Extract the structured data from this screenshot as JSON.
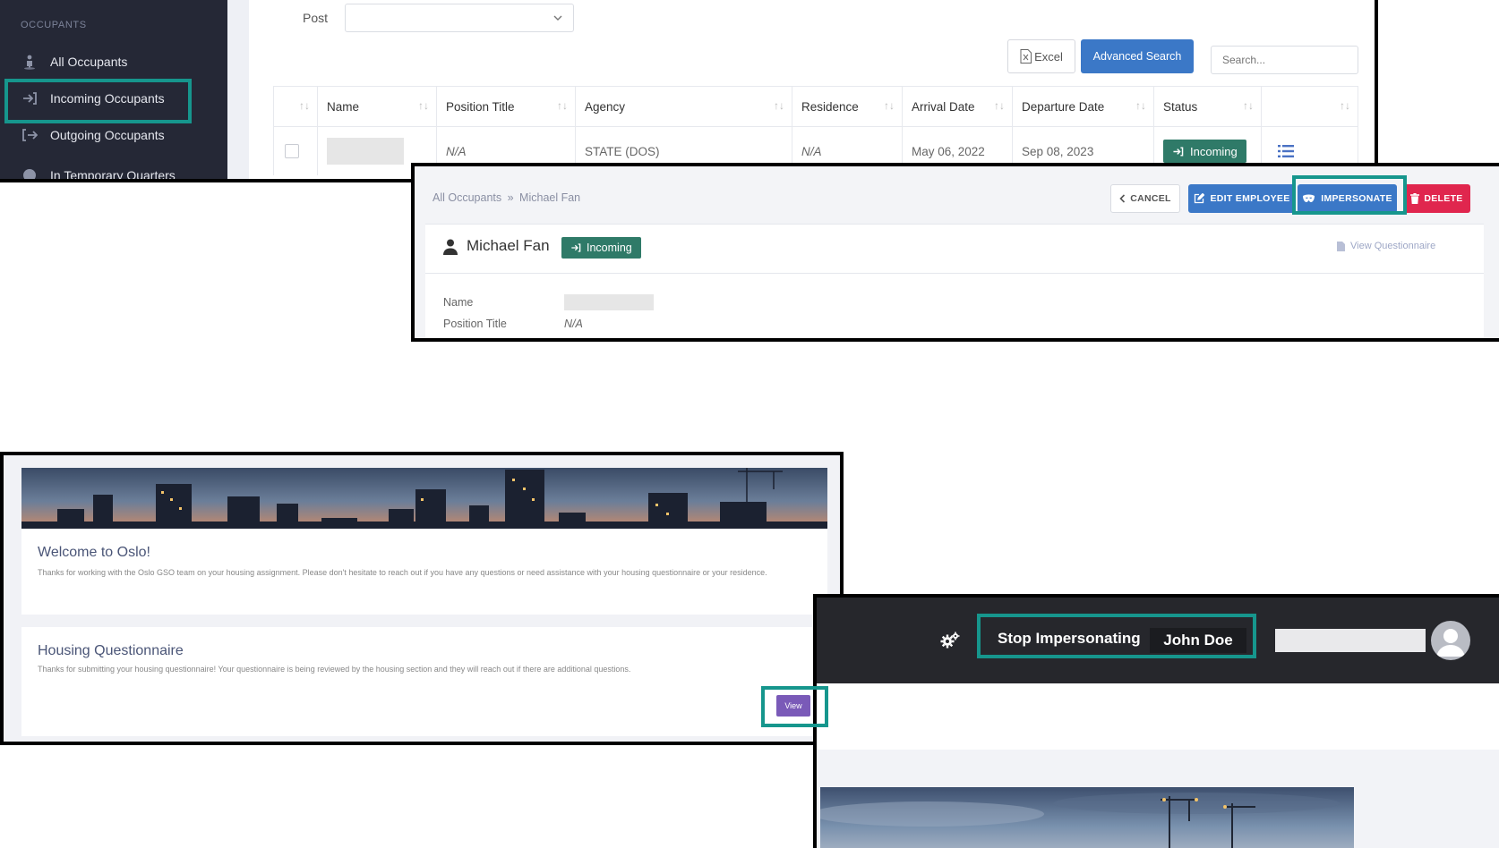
{
  "occupants_list": {
    "sidebar": {
      "section_header": "OCCUPANTS",
      "items": [
        {
          "label": "All Occupants",
          "icon": "person-icon"
        },
        {
          "label": "Incoming Occupants",
          "icon": "sign-in-icon"
        },
        {
          "label": "Outgoing Occupants",
          "icon": "sign-out-icon"
        },
        {
          "label": "In Temporary Quarters",
          "icon": "clock-icon"
        }
      ]
    },
    "filter": {
      "post_label": "Post",
      "post_value": ""
    },
    "toolbar": {
      "excel_label": "Excel",
      "advanced_search_label": "Advanced Search",
      "search_placeholder": "Search..."
    },
    "table": {
      "columns": [
        "Name",
        "Position Title",
        "Agency",
        "Residence",
        "Arrival Date",
        "Departure Date",
        "Status"
      ],
      "row": {
        "position_title": "N/A",
        "agency": "STATE (DOS)",
        "residence": "N/A",
        "arrival_date": "May 06, 2022",
        "departure_date": "Sep 08, 2023",
        "status": "Incoming"
      }
    }
  },
  "employee_detail": {
    "breadcrumb": {
      "root": "All Occupants",
      "separator": "»",
      "current": "Michael Fan"
    },
    "buttons": {
      "cancel": "CANCEL",
      "edit": "EDIT EMPLOYEE",
      "impersonate": "IMPERSONATE",
      "delete": "DELETE"
    },
    "name": "Michael Fan",
    "status_badge": "Incoming",
    "view_questionnaire": "View Questionnaire",
    "fields": [
      {
        "label": "Name",
        "value": ""
      },
      {
        "label": "Position Title",
        "value": "N/A"
      }
    ]
  },
  "portal": {
    "welcome_title": "Welcome to Oslo!",
    "welcome_text": "Thanks for working with the Oslo GSO team on your housing assignment.  Please don't hesitate to reach out if you have any questions or need assistance with your housing questionnaire or your residence.",
    "questionnaire_title": "Housing Questionnaire",
    "questionnaire_text": "Thanks for submitting your housing questionnaire! Your questionnaire is being reviewed by the housing section and they will reach out if there are additional questions.",
    "view_label": "View"
  },
  "impersonation_bar": {
    "stop_label": "Stop Impersonating",
    "user_name": "John Doe"
  },
  "colors": {
    "highlight": "#16968d",
    "primary": "#3b78c7",
    "success": "#2f7a68",
    "danger": "#e0264e",
    "view": "#7a5ab8"
  }
}
